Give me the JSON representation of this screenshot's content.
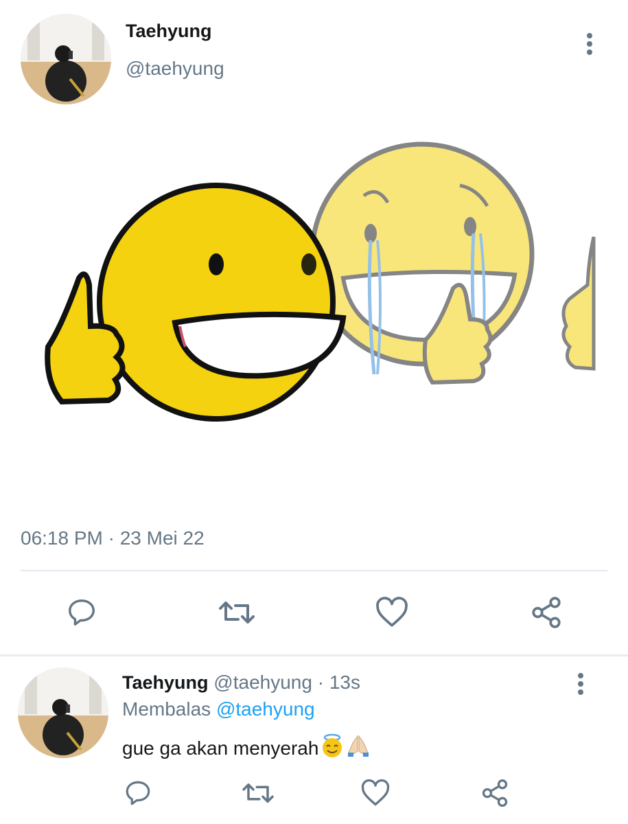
{
  "main_tweet": {
    "author_name": "Taehyung",
    "author_handle": "@taehyung",
    "timestamp": "06:18 PM · 23 Mei 22",
    "media_description_icon": "smiling-thumbs-up-meme-image",
    "actions": [
      {
        "icon": "reply-icon"
      },
      {
        "icon": "retweet-icon"
      },
      {
        "icon": "like-icon"
      },
      {
        "icon": "share-icon"
      }
    ]
  },
  "reply_tweet": {
    "author_name": "Taehyung",
    "author_handle": "@taehyung",
    "separator": "·",
    "time_ago": "13s",
    "replying_prefix": "Membalas",
    "replying_to": "@taehyung",
    "text": "gue ga akan menyerah",
    "emojis": [
      "smiling-face-with-halo-emoji",
      "folded-hands-emoji"
    ],
    "actions": [
      {
        "icon": "reply-icon"
      },
      {
        "icon": "retweet-icon"
      },
      {
        "icon": "like-icon"
      },
      {
        "icon": "share-icon"
      }
    ]
  },
  "colors": {
    "text_primary": "#14171a",
    "text_secondary": "#657786",
    "link": "#1da1f2",
    "divider": "#e1e8ed",
    "emoji_yellow": "#f5d20f"
  }
}
